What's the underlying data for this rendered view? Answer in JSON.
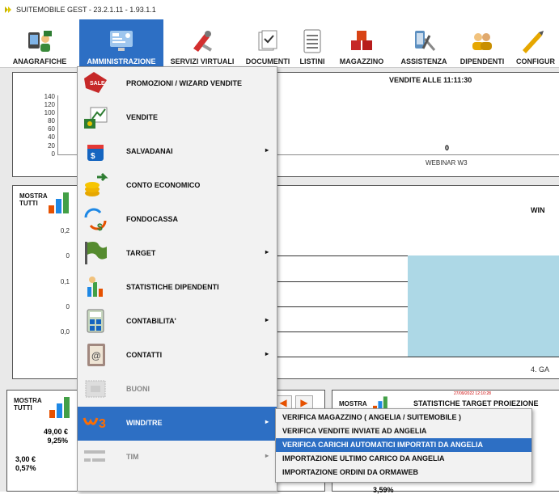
{
  "window": {
    "title": "SUITEMOBILE GEST - 23.2.1.11 - 1.93.1.1"
  },
  "toolbar": {
    "items": [
      {
        "label": "ANAGRAFICHE",
        "icon": "contacts-icon"
      },
      {
        "label": "AMMINISTRAZIONE",
        "icon": "admin-icon"
      },
      {
        "label": "SERVIZI VIRTUALI",
        "icon": "tools-icon"
      },
      {
        "label": "DOCUMENTI",
        "icon": "documents-icon"
      },
      {
        "label": "LISTINI",
        "icon": "list-icon"
      },
      {
        "label": "MAGAZZINO",
        "icon": "warehouse-icon"
      },
      {
        "label": "ASSISTENZA",
        "icon": "assistance-icon"
      },
      {
        "label": "DIPENDENTI",
        "icon": "employees-icon"
      },
      {
        "label": "CONFIGUR",
        "icon": "config-icon"
      }
    ],
    "active_color": "#2d6fc4"
  },
  "chart_top": {
    "title": "VENDITE ALLE 11:11:30",
    "y_ticks": [
      "140",
      "120",
      "100",
      "80",
      "60",
      "40",
      "20",
      "0"
    ],
    "value_label": "0",
    "category": "WEBINAR W3"
  },
  "chart_mid": {
    "mostra": "MOSTRA",
    "tutti": "TUTTI",
    "title_partial": "WIN",
    "y_ticks": [
      "0,2",
      "0",
      "0,1",
      "0",
      "0,0"
    ],
    "category_partial": "4. GA",
    "bar_color": "#add8e6"
  },
  "panel_bl": {
    "mostra": "MOSTRA",
    "tutti": "TUTTI",
    "value1": "49,00 €",
    "pct1": "9,25%",
    "value2": "3,00 €",
    "pct2": "0,57%"
  },
  "panel_br": {
    "mostra": "MOSTRA",
    "timestamp": "27/09/2022 12:10:28",
    "title": "STATISTICHE TARGET PROIEZIONE",
    "pct": "3,59%"
  },
  "menu": {
    "items": [
      {
        "label": "PROMOZIONI / WIZARD VENDITE",
        "has_sub": false
      },
      {
        "label": "VENDITE",
        "has_sub": false
      },
      {
        "label": "SALVADANAI",
        "has_sub": true
      },
      {
        "label": "CONTO ECONOMICO",
        "has_sub": false
      },
      {
        "label": "FONDOCASSA",
        "has_sub": false
      },
      {
        "label": "TARGET",
        "has_sub": true
      },
      {
        "label": "STATISTICHE DIPENDENTI",
        "has_sub": false
      },
      {
        "label": "CONTABILITA'",
        "has_sub": true
      },
      {
        "label": "CONTATTI",
        "has_sub": true
      },
      {
        "label": "BUONI",
        "has_sub": false
      },
      {
        "label": "WIND/TRE",
        "has_sub": true
      },
      {
        "label": "TIM",
        "has_sub": true
      }
    ],
    "sale_badge": "SALE",
    "highlight_index": 10
  },
  "submenu": {
    "items": [
      {
        "label": "VERIFICA MAGAZZINO ( ANGELIA / SUITEMOBILE )"
      },
      {
        "label": "VERIFICA VENDITE INVIATE AD ANGELIA"
      },
      {
        "label": "VERIFICA CARICHI AUTOMATICI IMPORTATI DA ANGELIA"
      },
      {
        "label": "IMPORTAZIONE ULTIMO CARICO DA ANGELIA"
      },
      {
        "label": "IMPORTAZIONE ORDINI DA ORMAWEB"
      }
    ],
    "highlight_index": 2
  },
  "arrow": "▸"
}
